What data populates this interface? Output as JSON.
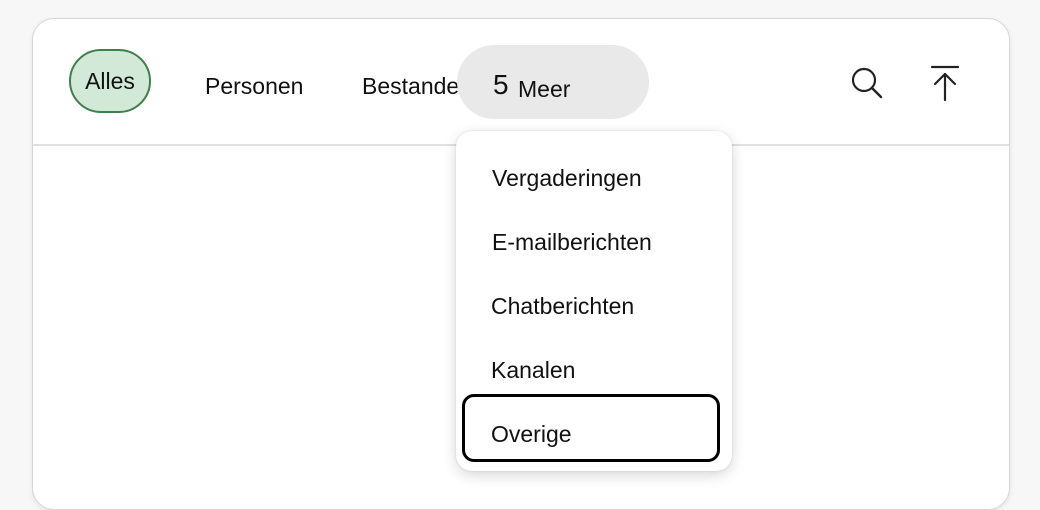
{
  "tabs": {
    "all_label": "Alles",
    "people_label": "Personen",
    "files_label": "Bestanden"
  },
  "more": {
    "count": "5",
    "label": "Meer"
  },
  "icons": {
    "search": "search-icon",
    "upload": "arrow-up-to-line-icon"
  },
  "dropdown": {
    "items": [
      {
        "label": "Vergaderingen"
      },
      {
        "label": "E-mailberichten"
      },
      {
        "label": "Chatberichten"
      },
      {
        "label": "Kanalen"
      },
      {
        "label": "Overige"
      }
    ],
    "focused_item": "Overige"
  },
  "colors": {
    "active_tab_fill": "#d3e9d7",
    "active_tab_border": "#3f7f49",
    "more_pill": "#e9e9e9",
    "focus_ring": "#000000"
  }
}
